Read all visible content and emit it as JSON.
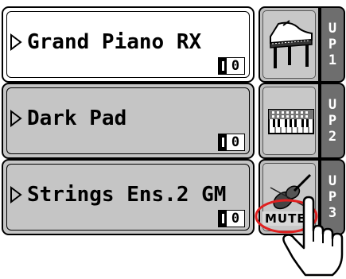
{
  "tracks": [
    {
      "name": "Grand Piano RX",
      "octave": "0",
      "tag": "UP1",
      "icon": "grand-piano-icon",
      "selected": true
    },
    {
      "name": "Dark Pad",
      "octave": "0",
      "tag": "UP2",
      "icon": "keyboard-icon",
      "selected": false
    },
    {
      "name": "Strings Ens.2 GM",
      "octave": "0",
      "tag": "UP3",
      "icon": "violin-icon",
      "selected": false
    }
  ],
  "mute_label": "MUTE",
  "colors": {
    "selected_bg": "#ffffff",
    "inactive_bg": "#c5c5c5",
    "tag_bg": "#6e6e6e",
    "highlight": "#e02020"
  }
}
